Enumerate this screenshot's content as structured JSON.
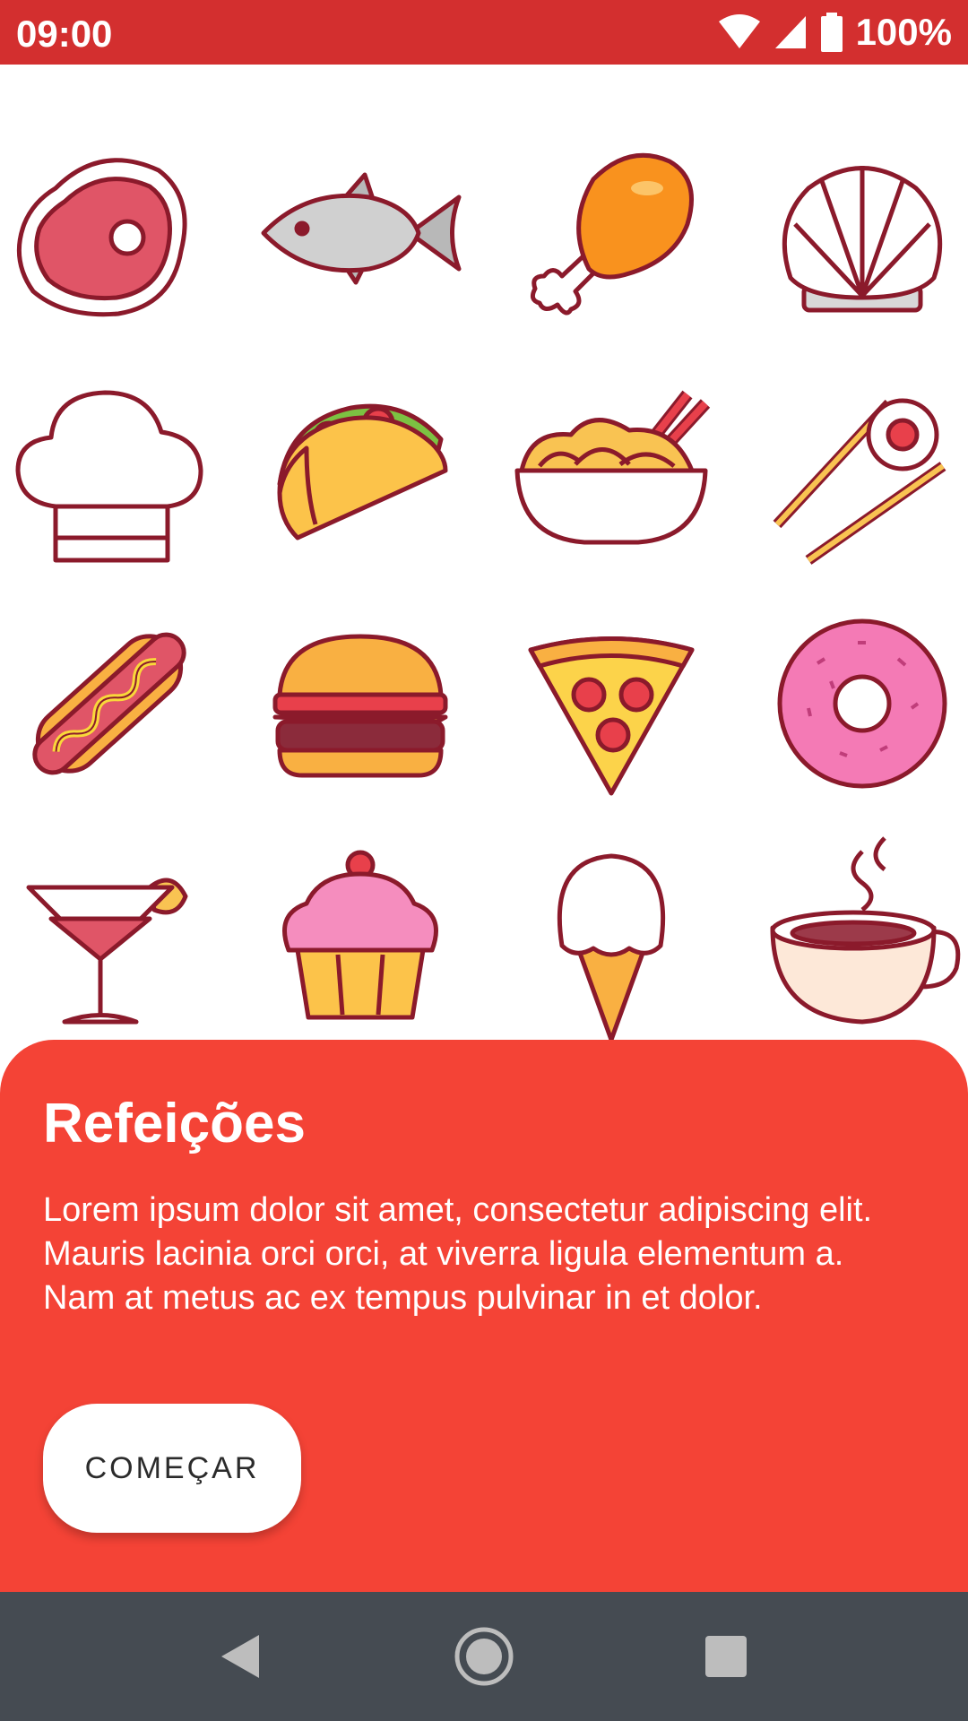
{
  "status_bar": {
    "time": "09:00",
    "battery_text": "100%",
    "icons": [
      "wifi-icon",
      "cell-signal-icon",
      "battery-icon"
    ]
  },
  "food_icons": [
    "steak-icon",
    "fish-icon",
    "chicken-leg-icon",
    "seashell-icon",
    "chef-hat-icon",
    "taco-icon",
    "noodle-bowl-icon",
    "sushi-chopsticks-icon",
    "hot-dog-icon",
    "burger-icon",
    "pizza-slice-icon",
    "donut-icon",
    "cocktail-icon",
    "cupcake-icon",
    "ice-cream-cone-icon",
    "coffee-cup-icon"
  ],
  "sheet": {
    "title": "Refeições",
    "body": "Lorem ipsum dolor sit amet, consectetur adipiscing elit. Mauris lacinia orci orci, at viverra ligula elementum a. Nam at metus ac ex tempus pulvinar in et dolor.",
    "button_label": "COMEÇAR"
  },
  "nav_bar": {
    "icons": [
      "back-icon",
      "home-icon",
      "recents-icon"
    ]
  },
  "colors": {
    "status_bar": "#D32F2F",
    "sheet": "#F44336",
    "nav_bar": "#454B52",
    "outline": "#8B1A2B"
  }
}
